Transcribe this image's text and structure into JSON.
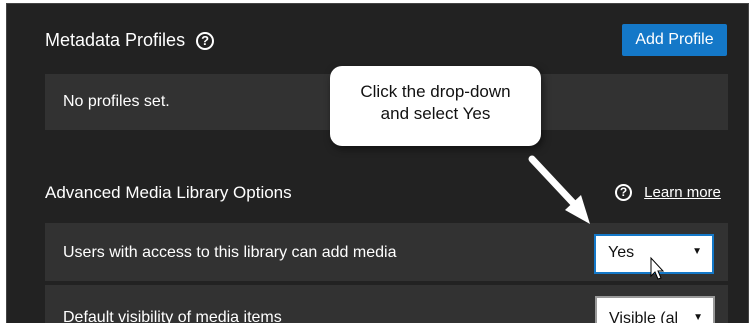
{
  "metadata": {
    "title": "Metadata Profiles",
    "help_glyph": "?",
    "add_button_label": "Add Profile",
    "empty_text": "No profiles set."
  },
  "callout": {
    "line1": "Click the drop-down",
    "line2": "and select Yes"
  },
  "advanced": {
    "title": "Advanced Media Library Options",
    "help_glyph": "?",
    "learn_more": "Learn more",
    "rows": [
      {
        "label": "Users with access to this library can add media",
        "value": "Yes"
      },
      {
        "label": "Default visibility of media items",
        "value": "Visible (al"
      }
    ],
    "dropdown_arrow": "▼"
  },
  "colors": {
    "background": "#222222",
    "row_background": "#323232",
    "accent": "#1478c8"
  }
}
